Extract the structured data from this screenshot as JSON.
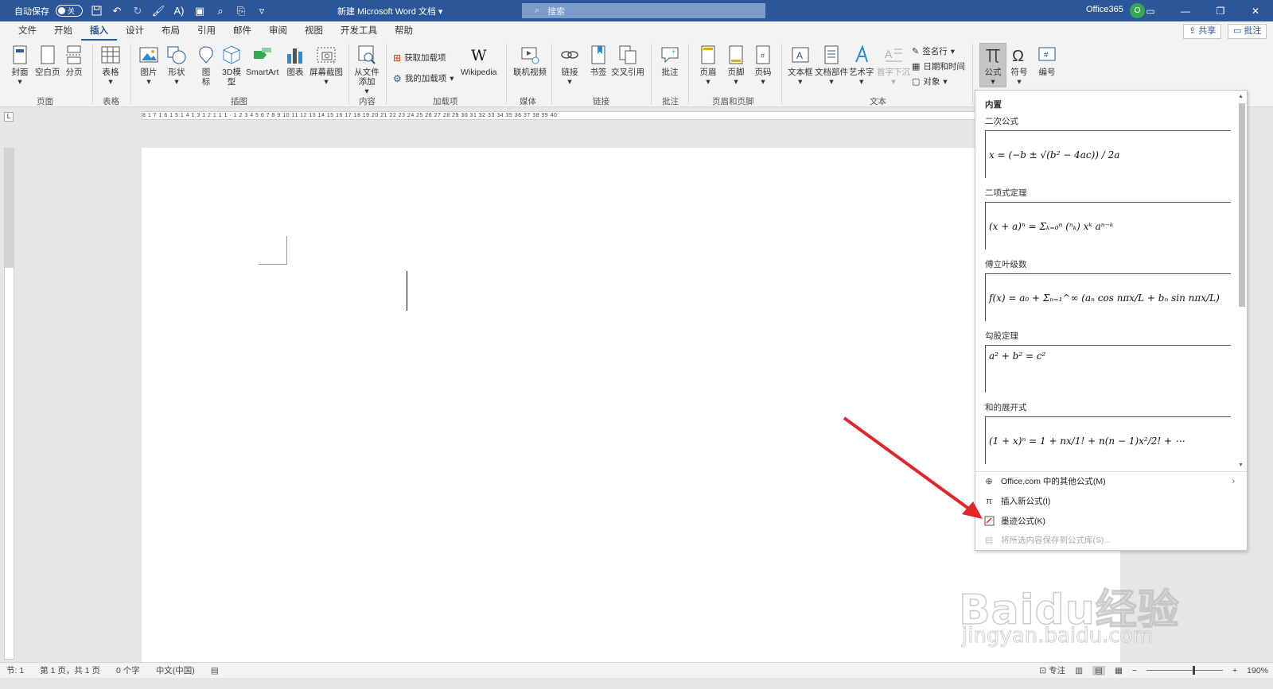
{
  "titlebar": {
    "autosave_label": "自动保存",
    "autosave_state": "关",
    "doc_title": "新建 Microsoft Word 文档 ▾",
    "search_placeholder": "搜索",
    "user": "Office365",
    "avatar_initial": "O"
  },
  "tabs": [
    "文件",
    "开始",
    "插入",
    "设计",
    "布局",
    "引用",
    "邮件",
    "审阅",
    "视图",
    "开发工具",
    "帮助"
  ],
  "share_label": "共享",
  "comment_label": "批注",
  "ribbon": {
    "buttons": {
      "cover": "封面",
      "blank_page": "空白页",
      "page_break": "分页",
      "table": "表格",
      "picture": "图片",
      "shapes": "形状",
      "icons": "图标",
      "model3d": "3D模型",
      "smartart": "SmartArt",
      "chart": "图表",
      "screenshot": "屏幕截图",
      "from_file": "从文件添加",
      "get_addins": "获取加载项",
      "my_addins": "我的加载项",
      "wikipedia": "Wikipedia",
      "online_video": "联机视频",
      "link": "链接",
      "bookmark": "书签",
      "cross_ref": "交叉引用",
      "comment": "批注",
      "header": "页眉",
      "footer": "页脚",
      "page_number": "页码",
      "text_box": "文本框",
      "quick_parts": "文档部件",
      "wordart": "艺术字",
      "drop_cap": "首字下沉",
      "signature_line": "签名行",
      "date_time": "日期和时间",
      "object": "对象",
      "equation": "公式",
      "symbol": "符号",
      "number": "编号"
    },
    "groups": {
      "pages": "页面",
      "tables": "表格",
      "illustrations": "插图",
      "content": "内容",
      "addins": "加载项",
      "media": "媒体",
      "links": "链接",
      "comments": "批注",
      "header_footer": "页眉和页脚",
      "text": "文本"
    }
  },
  "ruler_text": "8 1 7 1 6 1 5 1 4 1 3 1 2 1 1 1 · 1 2 3 4 5 6 7 8 9 10 11 12 13 14 15 16 17 18 19 20 21 22 23 24 25 26 27 28 29 30 31 32 33 34 35 36 37 38 39 40",
  "ruler_tab": "L",
  "equations": {
    "header": "内置",
    "items": [
      {
        "title": "二次公式",
        "formula": "x = (−b ± √(b² − 4ac)) / 2a"
      },
      {
        "title": "二项式定理",
        "formula": "(x + a)ⁿ = Σₖ₌₀ⁿ (ⁿₖ) xᵏ aⁿ⁻ᵏ"
      },
      {
        "title": "傅立叶级数",
        "formula": "f(x) = a₀ + Σₙ₌₁^∞ (aₙ cos nπx/L + bₙ sin nπx/L)"
      },
      {
        "title": "勾股定理",
        "formula": "a² + b² = c²"
      },
      {
        "title": "和的展开式",
        "formula": "(1 + x)ⁿ = 1 + nx/1! + n(n − 1)x²/2! + ⋯"
      }
    ],
    "menu": [
      {
        "label": "Office.com 中的其他公式(M)",
        "icon": "globe-icon"
      },
      {
        "label": "插入新公式(I)",
        "icon": "pi-icon"
      },
      {
        "label": "墨迹公式(K)",
        "icon": "ink-equation-icon"
      },
      {
        "label": "将所选内容保存到公式库(S)...",
        "icon": "save-icon"
      }
    ]
  },
  "statusbar": {
    "section": "节: 1",
    "page": "第 1 页，共 1 页",
    "words": "0 个字",
    "language": "中文(中国)",
    "focus": "专注",
    "zoom_minus": "−",
    "zoom_plus": "+",
    "zoom_value": "190%"
  },
  "watermark": {
    "brand": "Baidu经验",
    "url": "jingyan.baidu.com"
  },
  "colors": {
    "title_bar": "#2b579a",
    "arrow": "#e0262b"
  }
}
